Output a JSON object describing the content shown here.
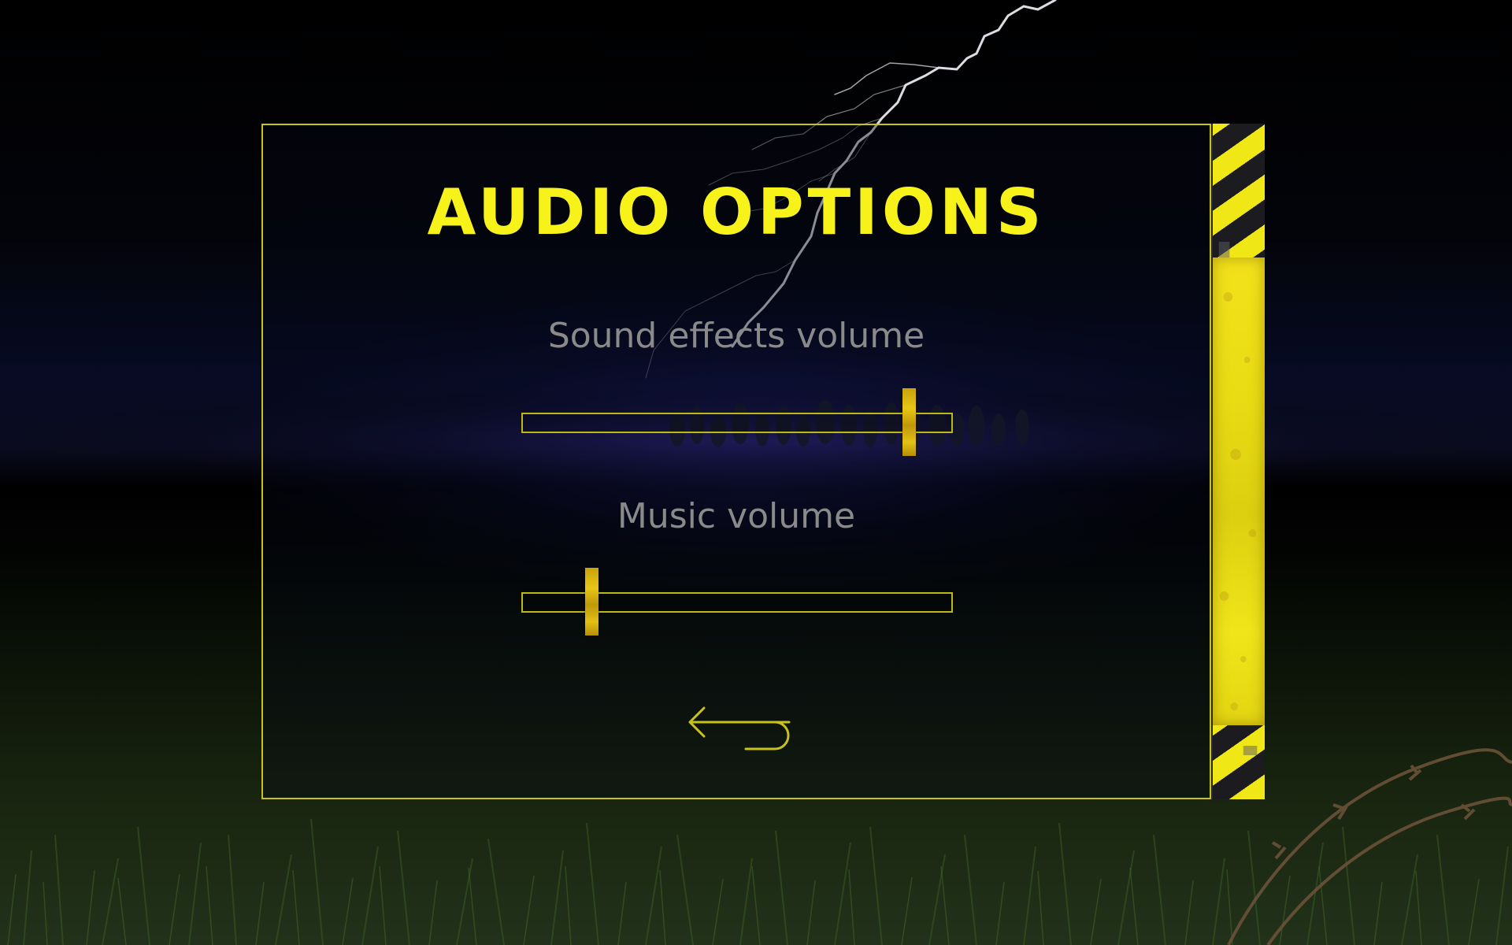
{
  "screen": {
    "title": "AUDIO OPTIONS"
  },
  "sliders": [
    {
      "label": "Sound effects volume",
      "value": 0.9
    },
    {
      "label": "Music volume",
      "value": 0.16
    }
  ],
  "back_button": {
    "icon": "return-arrow-icon"
  },
  "colors": {
    "accent_yellow": "#f7f21a",
    "frame_yellow": "#c9c21a",
    "label_gray": "#8a8a8a",
    "stripe_dark": "#1c1c20"
  }
}
